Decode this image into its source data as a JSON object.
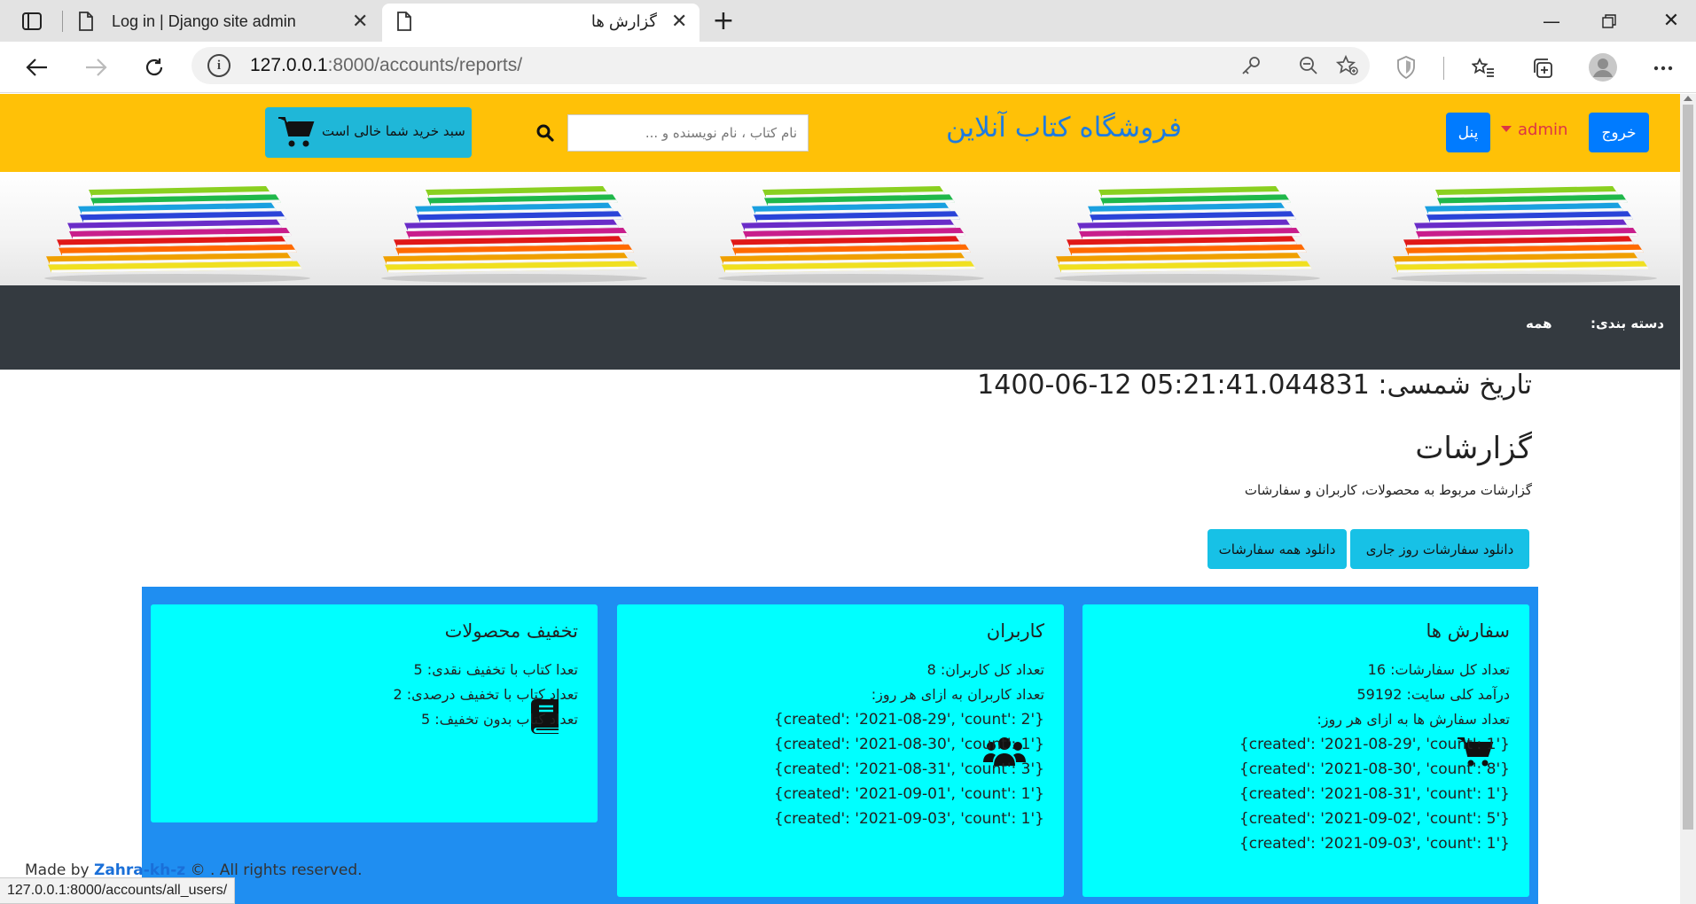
{
  "browser": {
    "tabs": [
      {
        "title": "Log in | Django site admin",
        "active": false
      },
      {
        "title": "گزارش ها",
        "active": true
      }
    ],
    "url_host": "127.0.0.1",
    "url_rest": ":8000/accounts/reports/",
    "status_url": "127.0.0.1:8000/accounts/all_users/"
  },
  "header": {
    "logout_label": "خروج",
    "user_label": "admin",
    "panel_label": "پنل",
    "site_title": "فروشگاه کتاب آنلاین",
    "search_placeholder": "نام کتاب ، نام نویسنده و ...",
    "cart_label": "سبد خرید شما خالی است",
    "colors": {
      "header_bg": "#ffc107",
      "primary": "#007bff",
      "title": "#1e7be0"
    }
  },
  "category_bar": {
    "label": "دسته بندی:",
    "all": "همه"
  },
  "page": {
    "date_label": "تاریخ شمسی:",
    "date_value": "1400-06-12 05:21:41.044831",
    "title": "گزارشات",
    "description": "گزارشات مربوط به محصولات، کاربران و سفارشات",
    "download_today_label": "دانلود سفارشات روز جاری",
    "download_all_label": "دانلود همه سفارشات"
  },
  "cards": {
    "orders": {
      "title": "سفارش ها",
      "icon": "shopping-cart-icon",
      "total": "تعداد کل سفارشات: 16",
      "income": "درآمد کلی سایت: 59192",
      "per_day_label": "تعداد سفارش ها به ازای هر روز:",
      "rows": [
        "{created': '2021-08-29', 'count': 1'}",
        "{created': '2021-08-30', 'count': 8'}",
        "{created': '2021-08-31', 'count': 1'}",
        "{created': '2021-09-02', 'count': 5'}",
        "{created': '2021-09-03', 'count': 1'}"
      ]
    },
    "users": {
      "title": "کاربران",
      "icon": "users-icon",
      "total": "تعداد کل کاربران: 8",
      "per_day_label": "تعداد کاربران به ازای هر روز:",
      "rows": [
        "{created': '2021-08-29', 'count': 2'}",
        "{created': '2021-08-30', 'count': 1'}",
        "{created': '2021-08-31', 'count': 3'}",
        "{created': '2021-09-01', 'count': 1'}",
        "{created': '2021-09-03', 'count': 1'}"
      ]
    },
    "discounts": {
      "title": "تخفیف محصولات",
      "icon": "book-icon",
      "cash": "تعدا کتاب با تخفیف نقدی: 5",
      "percent": "تعداد کتاب با تخفیف درصدی: 2",
      "none": "تعداد کتاب بدون تخفیف: 5"
    }
  },
  "footer": {
    "made_by": "Made by",
    "author": "Zahra-kh-z",
    "rights": "© . All rights reserved."
  }
}
